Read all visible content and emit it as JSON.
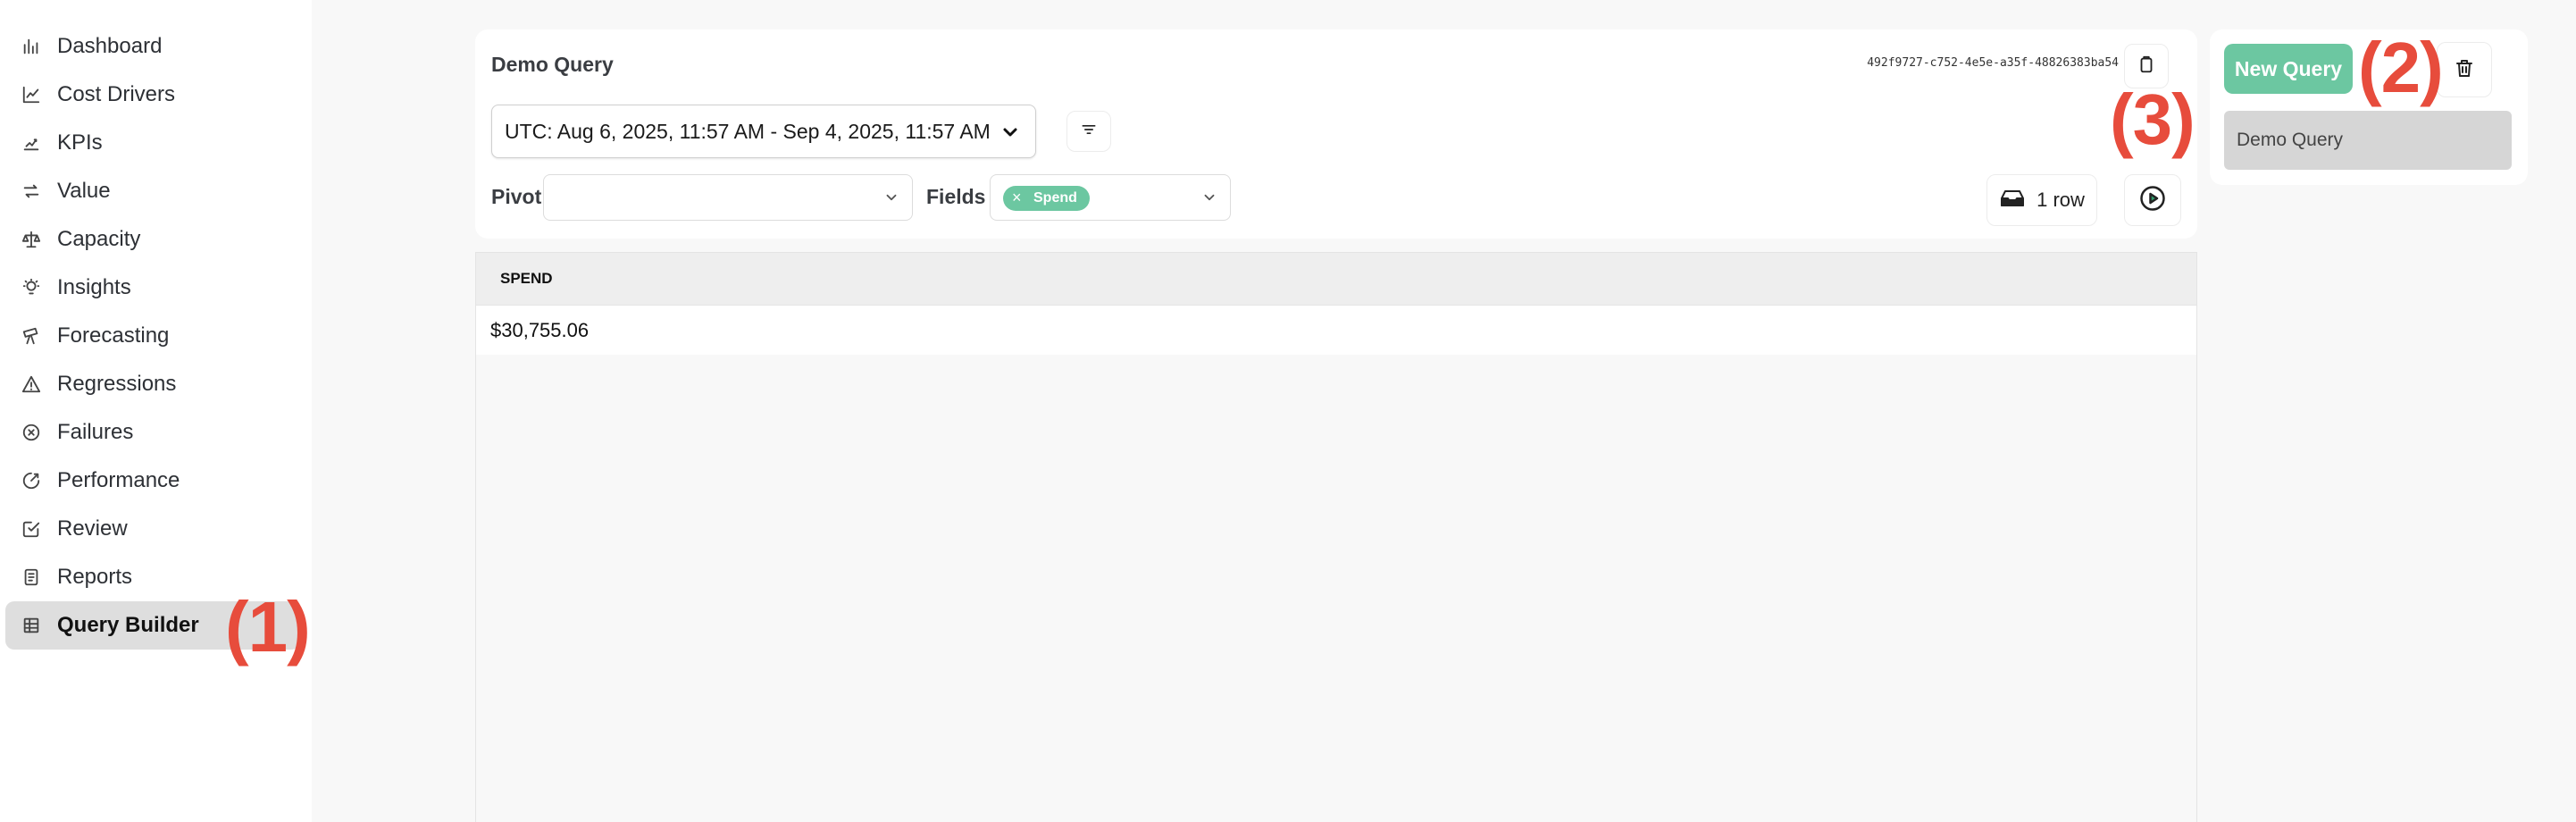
{
  "sidebar": {
    "items": [
      {
        "label": "Dashboard",
        "icon": "bar-chart-icon"
      },
      {
        "label": "Cost Drivers",
        "icon": "line-chart-icon"
      },
      {
        "label": "KPIs",
        "icon": "kpi-chart-icon"
      },
      {
        "label": "Value",
        "icon": "exchange-icon"
      },
      {
        "label": "Capacity",
        "icon": "scale-icon"
      },
      {
        "label": "Insights",
        "icon": "lightbulb-icon"
      },
      {
        "label": "Forecasting",
        "icon": "telescope-icon"
      },
      {
        "label": "Regressions",
        "icon": "warning-triangle-icon"
      },
      {
        "label": "Failures",
        "icon": "circle-x-icon"
      },
      {
        "label": "Performance",
        "icon": "gauge-icon"
      },
      {
        "label": "Review",
        "icon": "edit-check-icon"
      },
      {
        "label": "Reports",
        "icon": "document-icon"
      },
      {
        "label": "Query Builder",
        "icon": "table-icon",
        "active": true
      }
    ]
  },
  "annotations": {
    "a1": "(1)",
    "a2": "(2)",
    "a3": "(3)"
  },
  "query": {
    "title": "Demo Query",
    "id": "492f9727-c752-4e5e-a35f-48826383ba54",
    "date_range": "UTC: Aug 6, 2025, 11:57 AM - Sep 4, 2025, 11:57 AM",
    "pivot_label": "Pivot",
    "pivot_value": "",
    "fields_label": "Fields",
    "fields_chip": "Spend",
    "row_count": "1 row"
  },
  "results": {
    "columns": [
      "SPEND"
    ],
    "rows": [
      [
        "$30,755.06"
      ]
    ]
  },
  "saved": {
    "new_query_label": "New Query",
    "items": [
      "Demo Query"
    ]
  },
  "colors": {
    "accent": "#6cc7a1",
    "annotation": "#e74c3c",
    "active_nav": "#dedede"
  }
}
